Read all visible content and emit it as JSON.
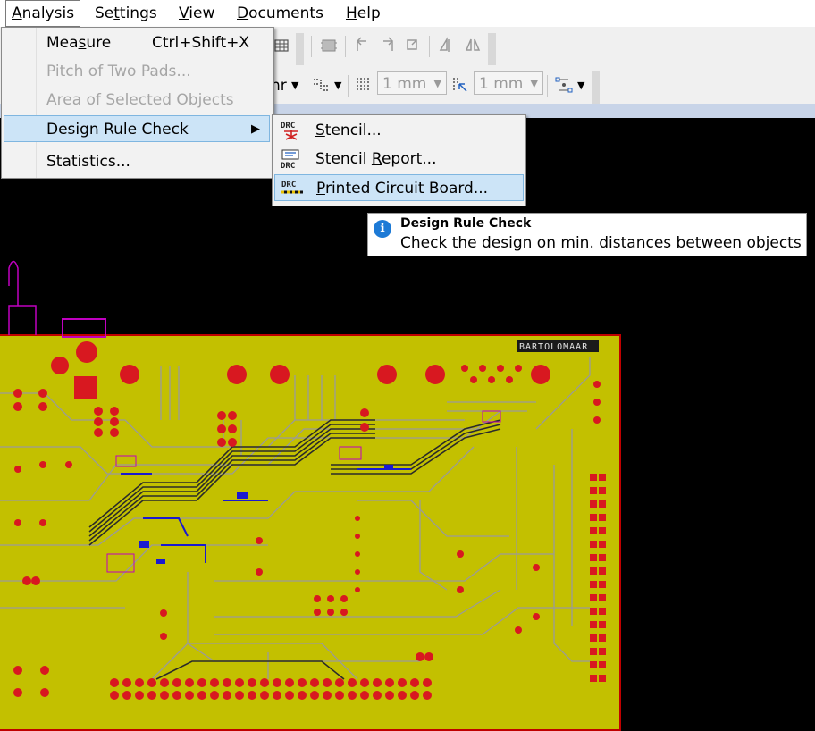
{
  "menubar": {
    "items": [
      {
        "label": "Analysis",
        "underline": "A",
        "rest": "nalysis"
      },
      {
        "label": "Settings",
        "pre": "Se",
        "underline": "t",
        "rest": "tings"
      },
      {
        "label": "View",
        "underline": "V",
        "rest": "iew"
      },
      {
        "label": "Documents",
        "underline": "D",
        "rest": "ocuments"
      },
      {
        "label": "Help",
        "underline": "H",
        "rest": "elp"
      }
    ]
  },
  "toolbar": {
    "grid_label": "1 mm",
    "snap_label": "1 mm",
    "unit_fragment": "nr"
  },
  "analysis_menu": {
    "items": [
      {
        "label_pre": "Mea",
        "label_u": "s",
        "label_post": "ure",
        "shortcut": "Ctrl+Shift+X",
        "enabled": true
      },
      {
        "label": "Pitch of Two Pads...",
        "enabled": false
      },
      {
        "label": "Area of Selected Objects",
        "enabled": false
      },
      {
        "label": "Design Rule Check",
        "enabled": true,
        "submenu": true
      },
      {
        "label": "Statistics...",
        "enabled": true
      }
    ],
    "submenu_arrow": "▶"
  },
  "drc_submenu": {
    "items": [
      {
        "label_u": "S",
        "label_post": "tencil...",
        "icon": "drc-stencil-icon"
      },
      {
        "label_pre": "Stencil ",
        "label_u": "R",
        "label_post": "eport...",
        "icon": "drc-stencil-report-icon"
      },
      {
        "label_u": "P",
        "label_post": "rinted Circuit Board...",
        "icon": "drc-pcb-icon"
      }
    ],
    "icon_text": "DRC"
  },
  "tooltip": {
    "title": "Design Rule Check",
    "body": "Check the design on min. distances between objects",
    "icon": "info-icon",
    "icon_glyph": "i"
  },
  "pcb": {
    "board_label": "BARTOLOMAAR",
    "colors": {
      "board": "#c3c000",
      "outline": "#c00000",
      "pad": "#d81820",
      "silk": "#c000c0",
      "trace_blue": "#1a1ad0",
      "trace_gray": "#b0b0b0"
    }
  }
}
